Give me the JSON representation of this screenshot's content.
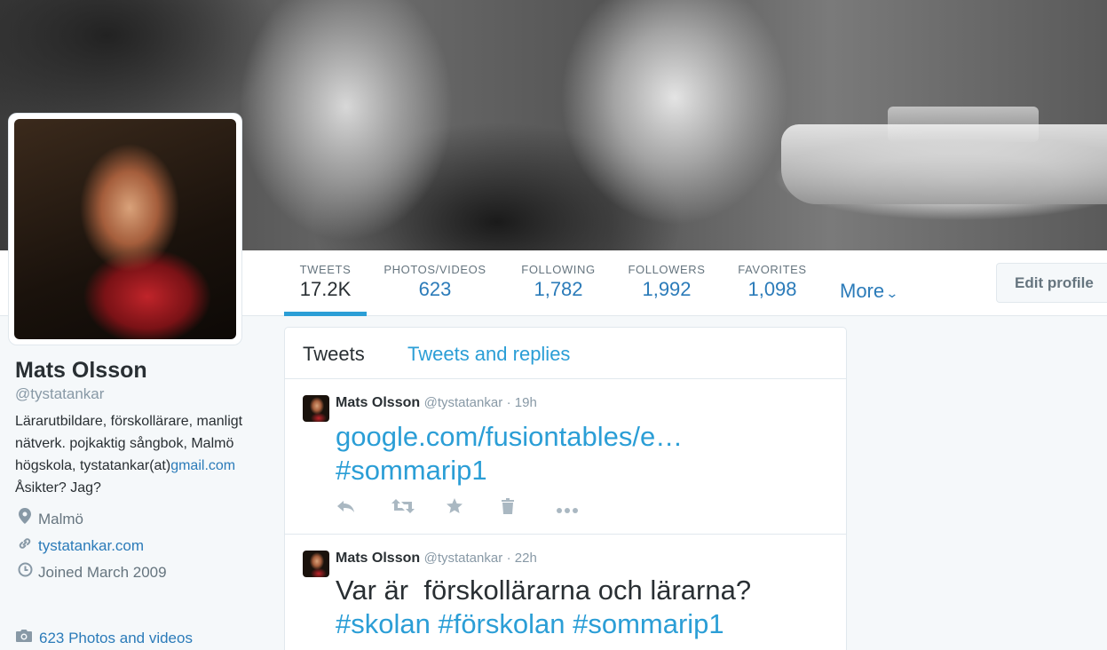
{
  "profile": {
    "name": "Mats Olsson",
    "handle": "@tystatankar",
    "bio_text": "Lärarutbildare, förskollärare, manligt nätverk. pojkaktig sångbok, Malmö högskola, tystatankar(at)",
    "bio_link": "gmail.com",
    "bio_end": "Åsikter? Jag?",
    "location": "Malmö",
    "website": "tystatankar.com",
    "joined": "Joined March 2009",
    "photos_link": "623 Photos and videos"
  },
  "nav": {
    "stats": [
      {
        "label": "TWEETS",
        "value": "17.2K"
      },
      {
        "label": "PHOTOS/VIDEOS",
        "value": "623"
      },
      {
        "label": "FOLLOWING",
        "value": "1,782"
      },
      {
        "label": "FOLLOWERS",
        "value": "1,992"
      },
      {
        "label": "FAVORITES",
        "value": "1,098"
      }
    ],
    "more_label": "More",
    "edit_profile_label": "Edit profile"
  },
  "timeline": {
    "tabs": [
      "Tweets",
      "Tweets and replies"
    ],
    "tweets": [
      {
        "name": "Mats Olsson",
        "handle": "@tystatankar",
        "time": "· 19h",
        "link": "google.com/fusiontables/e…",
        "hashtags": "#sommarip1"
      },
      {
        "name": "Mats Olsson",
        "handle": "@tystatankar",
        "time": "· 22h",
        "text": "Var är  förskollärarna och lärarna?",
        "hashtags": "#skolan #förskolan #sommarip1"
      }
    ]
  },
  "icons": {
    "location": "map-pin-icon",
    "website": "link-icon",
    "joined": "clock-icon",
    "photos": "camera-icon",
    "more_chevron": "chevron-down-icon"
  },
  "colors": {
    "link_blue": "#2b7bb9",
    "accent_blue": "#2b9ed6",
    "text": "#292f33",
    "muted": "#8899a6"
  }
}
